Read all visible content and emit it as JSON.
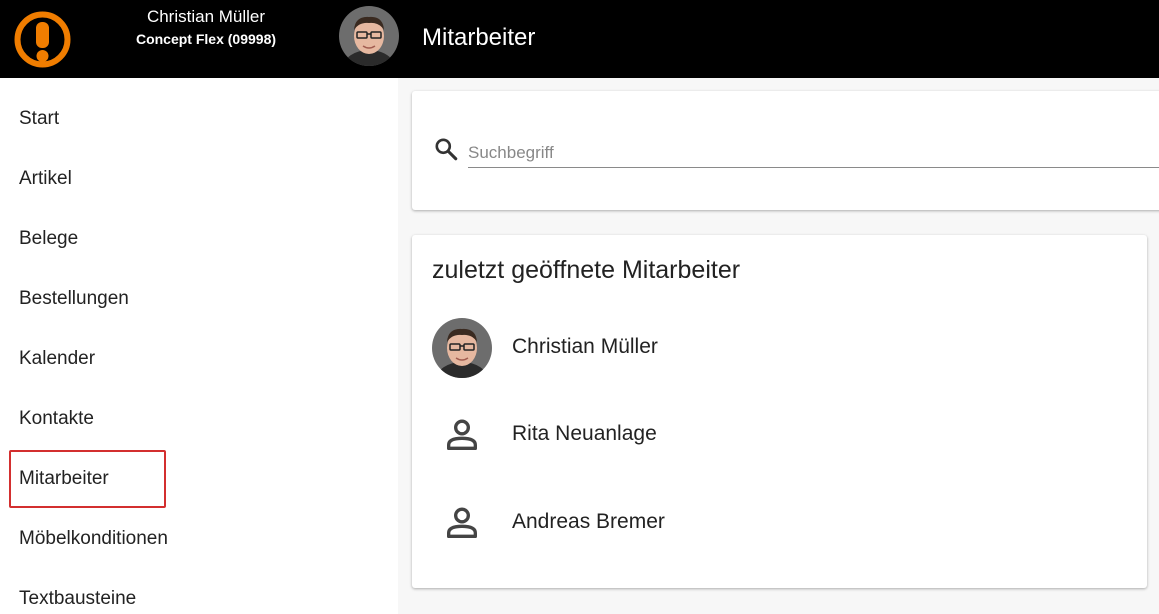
{
  "header": {
    "user_name": "Christian Müller",
    "company": "Concept Flex (09998)",
    "page_title": "Mitarbeiter",
    "logo_icon": "alert-logo-icon",
    "accent_color": "#f07d00"
  },
  "sidebar": {
    "items": [
      {
        "label": "Start"
      },
      {
        "label": "Artikel"
      },
      {
        "label": "Belege"
      },
      {
        "label": "Bestellungen"
      },
      {
        "label": "Kalender"
      },
      {
        "label": "Kontakte"
      },
      {
        "label": "Mitarbeiter",
        "highlighted": true
      },
      {
        "label": "Möbelkonditionen"
      },
      {
        "label": "Textbausteine"
      }
    ]
  },
  "search": {
    "placeholder": "Suchbegriff",
    "value": ""
  },
  "recent": {
    "title": "zuletzt geöffnete Mitarbeiter",
    "items": [
      {
        "name": "Christian Müller",
        "icon": "avatar-photo"
      },
      {
        "name": "Rita Neuanlage",
        "icon": "person-icon"
      },
      {
        "name": "Andreas Bremer",
        "icon": "person-icon"
      }
    ]
  }
}
